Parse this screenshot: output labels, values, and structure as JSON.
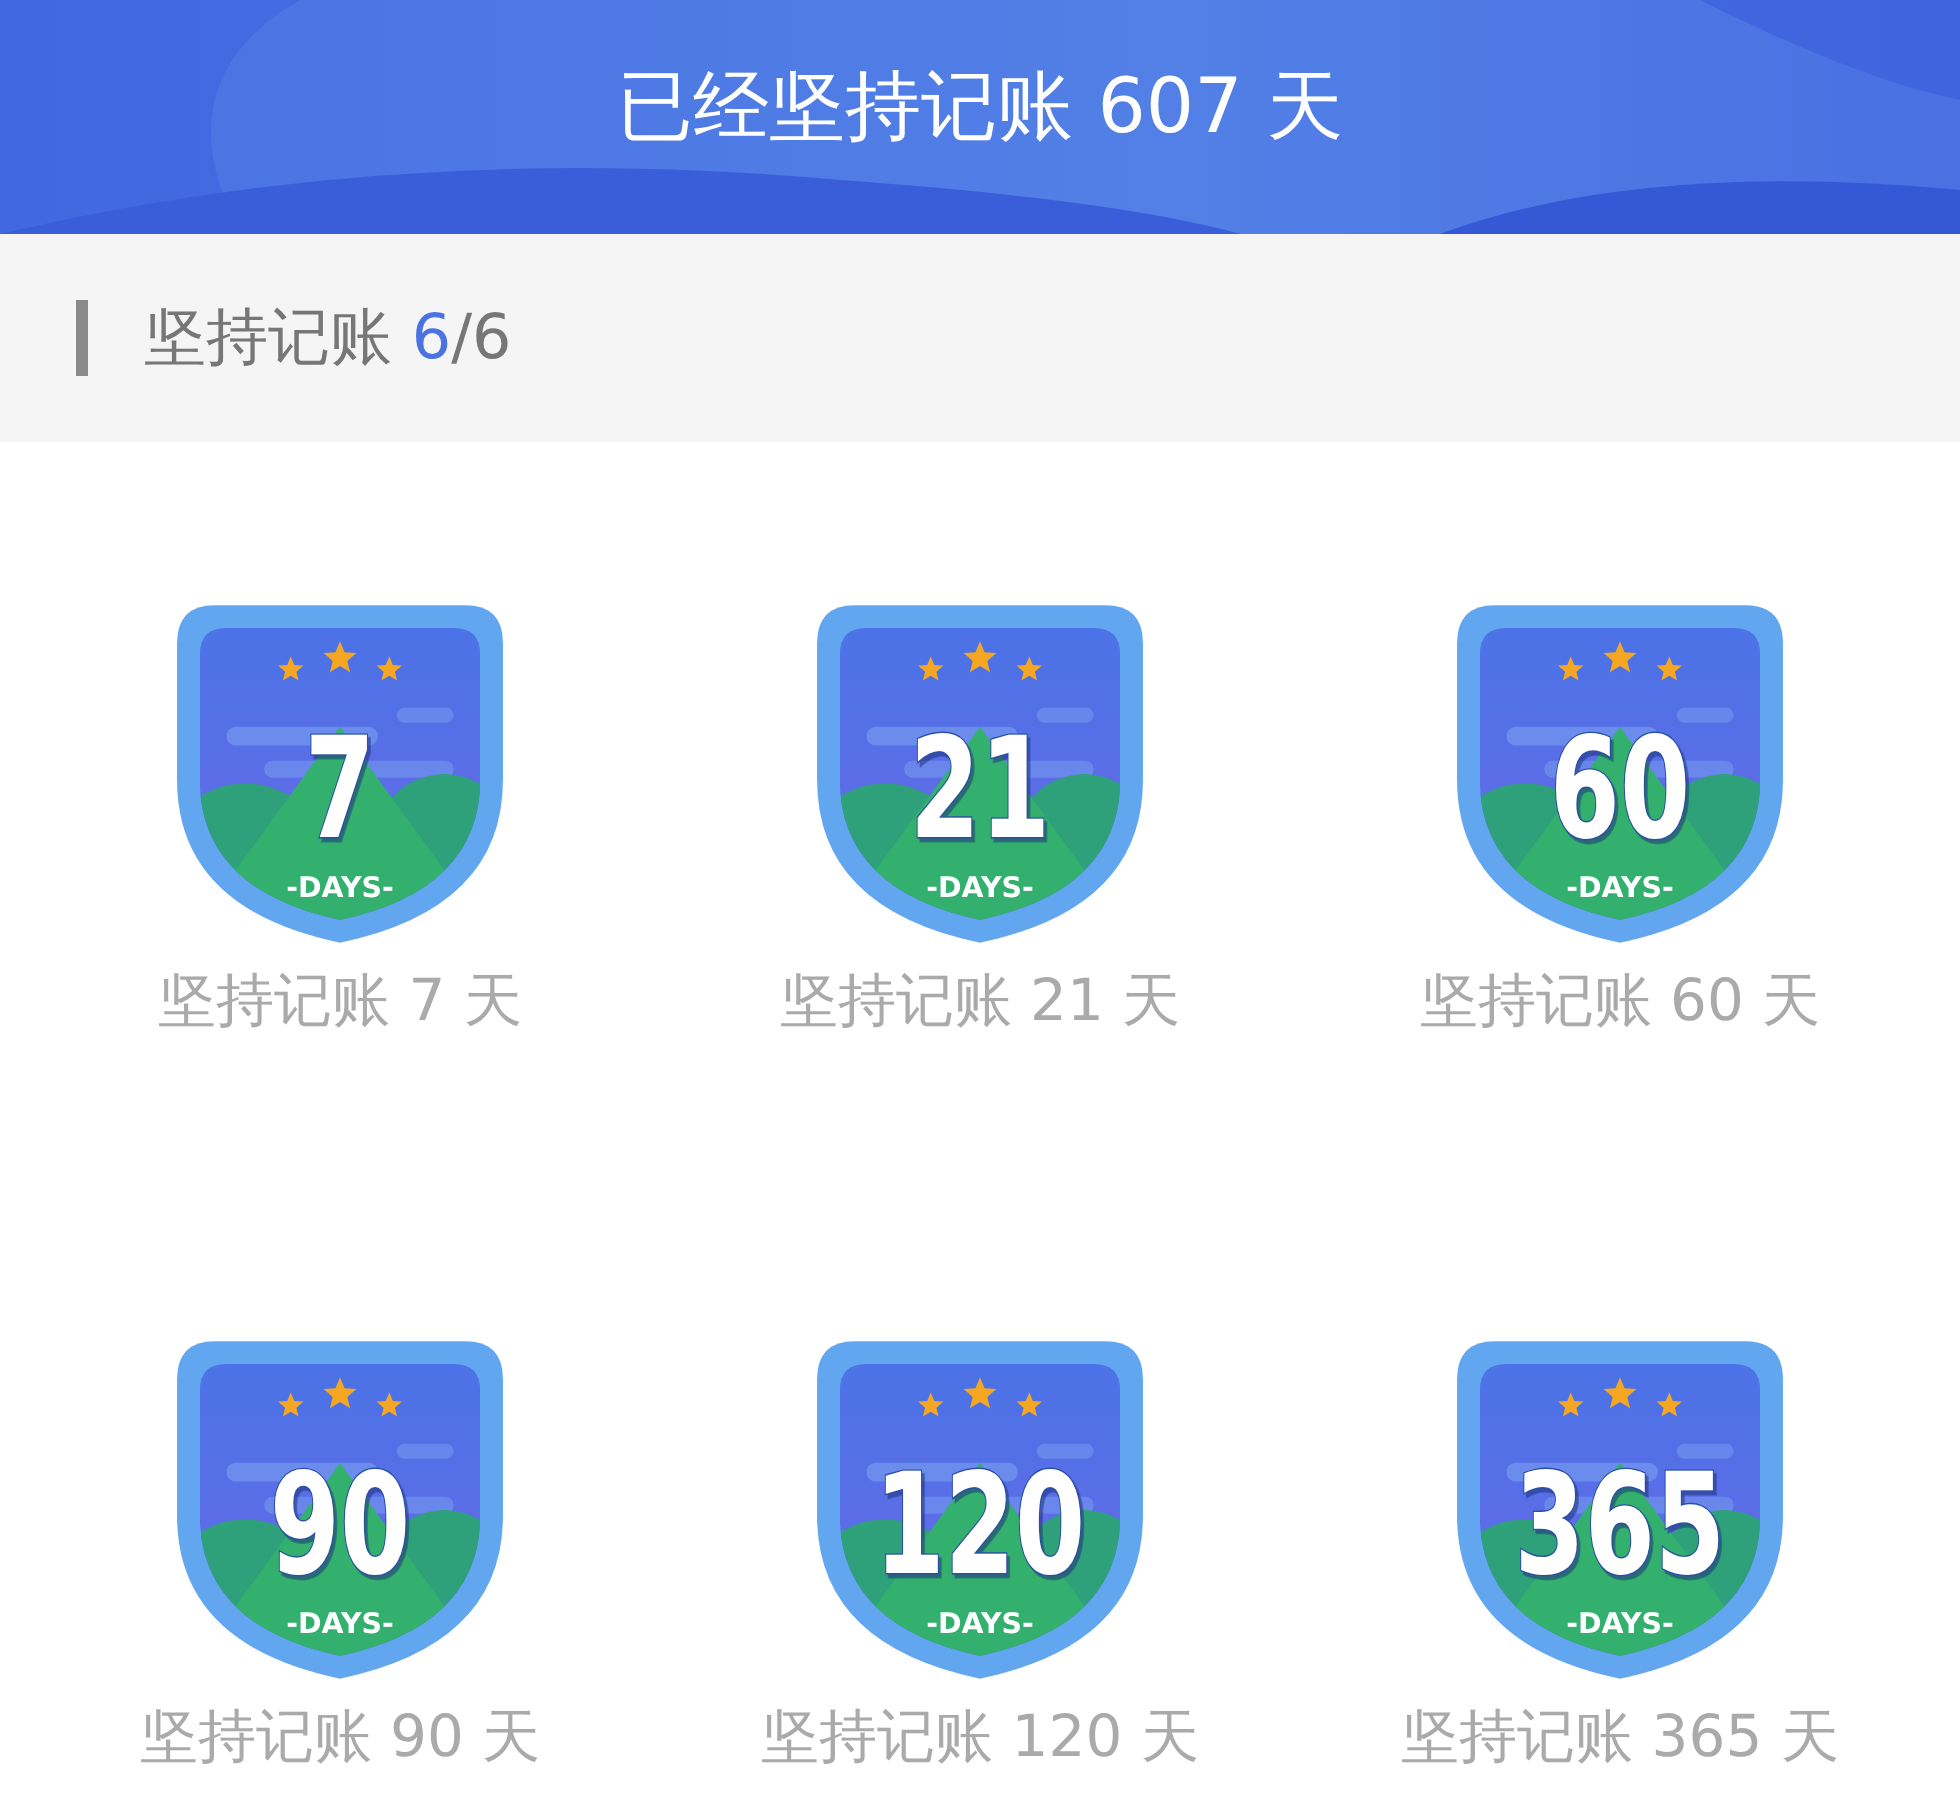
{
  "header": {
    "title": "已经坚持记账 607 天"
  },
  "section": {
    "title": "坚持记账",
    "count_done": "6",
    "count_rest": "/6"
  },
  "badges": [
    {
      "number": "7",
      "unit": "-DAYS-",
      "label": "坚持记账 7 天"
    },
    {
      "number": "21",
      "unit": "-DAYS-",
      "label": "坚持记账 21 天"
    },
    {
      "number": "60",
      "unit": "-DAYS-",
      "label": "坚持记账 60 天"
    },
    {
      "number": "90",
      "unit": "-DAYS-",
      "label": "坚持记账 90 天"
    },
    {
      "number": "120",
      "unit": "-DAYS-",
      "label": "坚持记账 120 天"
    },
    {
      "number": "365",
      "unit": "-DAYS-",
      "label": "坚持记账 365 天"
    }
  ]
}
